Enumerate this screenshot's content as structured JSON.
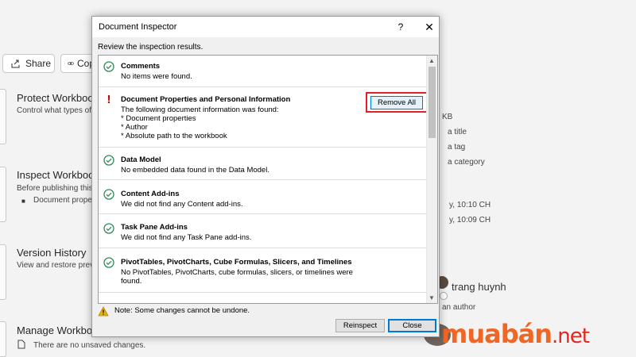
{
  "background": {
    "share_label": "Share",
    "copy_label": "Cop",
    "cards": [
      {
        "title": "Protect Workboo",
        "desc": "Control what types of"
      },
      {
        "title": "Inspect Workboo",
        "desc": "Before publishing this",
        "bullet": "Document prope"
      },
      {
        "title": "Version History",
        "desc": "View and restore previ"
      },
      {
        "title": "Manage Workboo",
        "desc": "There are no unsaved changes."
      }
    ],
    "right_panel": {
      "size": "KB",
      "add_title": "a title",
      "add_tag": "a tag",
      "add_category": "a category",
      "modified": "y, 10:10 CH",
      "created": "y, 10:09 CH",
      "author_name": "trang huynh",
      "add_author": "an author"
    },
    "watermark": {
      "brand": "muabán",
      "tld": ".net"
    }
  },
  "dialog": {
    "title": "Document Inspector",
    "help_label": "?",
    "close_label": "✕",
    "subtitle": "Review the inspection results.",
    "items": [
      {
        "status": "ok",
        "heading": "Comments",
        "lines": [
          "No items were found."
        ]
      },
      {
        "status": "issue",
        "heading": "Document Properties and Personal Information",
        "lines": [
          "The following document information was found:",
          "* Document properties",
          "* Author",
          "* Absolute path to the workbook"
        ],
        "action_label": "Remove All"
      },
      {
        "status": "ok",
        "heading": "Data Model",
        "lines": [
          "No embedded data found in the Data Model."
        ]
      },
      {
        "status": "ok",
        "heading": "Content Add-ins",
        "lines": [
          "We did not find any Content add-ins."
        ]
      },
      {
        "status": "ok",
        "heading": "Task Pane Add-ins",
        "lines": [
          "We did not find any Task Pane add-ins."
        ]
      },
      {
        "status": "ok",
        "heading": "PivotTables, PivotCharts, Cube Formulas, Slicers, and Timelines",
        "lines": [
          "No PivotTables, PivotCharts, cube formulas, slicers, or timelines were",
          "found."
        ]
      }
    ],
    "note": "Note: Some changes cannot be undone.",
    "reinspect_label": "Reinspect",
    "close_button_label": "Close"
  },
  "colors": {
    "ok_green": "#2e8b57",
    "issue_red": "#d00000",
    "highlight_red": "#e0202a",
    "warning_yellow": "#e8b400"
  }
}
